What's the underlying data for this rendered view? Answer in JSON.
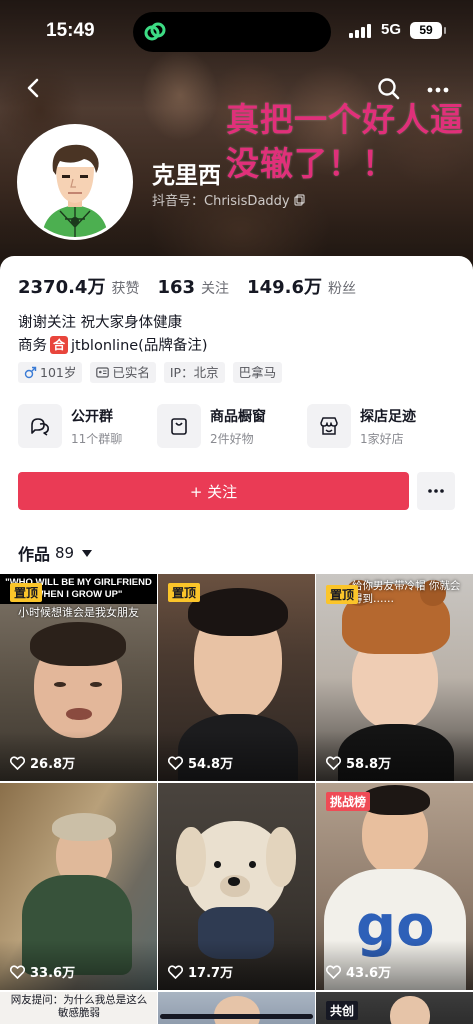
{
  "status_bar": {
    "time": "15:49",
    "network": "5G",
    "battery": "59"
  },
  "header": {
    "overlay_text": "真把一个好人逼没辙了！！",
    "name": "克里西",
    "handle": "抖音号：ChrisisDaddy"
  },
  "stats": [
    {
      "value": "2370.4万",
      "label": "获赞"
    },
    {
      "value": "163",
      "label": "关注"
    },
    {
      "value": "149.6万",
      "label": "粉丝"
    }
  ],
  "bio": {
    "line1": "谢谢关注 祝大家身体健康",
    "business_prefix": "商务",
    "business_badge": "合",
    "business_text": "jtblonline(品牌备注)"
  },
  "tags": [
    {
      "icon": "male-icon",
      "text": "101岁"
    },
    {
      "icon": "id-card-icon",
      "text": "已实名"
    },
    {
      "icon": "",
      "text": "IP：北京"
    },
    {
      "icon": "",
      "text": "巴拿马"
    }
  ],
  "shortcuts": [
    {
      "icon": "group-chat-icon",
      "title": "公开群",
      "sub": "11个群聊"
    },
    {
      "icon": "shop-window-icon",
      "title": "商品橱窗",
      "sub": "2件好物"
    },
    {
      "icon": "store-icon",
      "title": "探店足迹",
      "sub": "1家好店"
    }
  ],
  "actions": {
    "follow": "+ 关注"
  },
  "works": {
    "label": "作品",
    "count": "89"
  },
  "videos": [
    {
      "likes": "26.8万",
      "badge": "置顶",
      "caption_top": "\"WHO WILL BE MY GIRLFRIEND WHEN I GROW UP\"",
      "caption_sub": "小时候想谁会是我女朋友"
    },
    {
      "likes": "54.8万",
      "badge": "置顶"
    },
    {
      "likes": "58.8万",
      "badge": "置顶",
      "caption": "给你男友带冷帽 你就会得到……"
    },
    {
      "likes": "33.6万"
    },
    {
      "likes": "17.7万"
    },
    {
      "likes": "43.6万",
      "badge": "挑战榜"
    },
    {
      "caption": "网友提问：为什么我总是这么敏感脆弱"
    },
    {},
    {
      "caption": "共创"
    }
  ],
  "colors": {
    "accent": "#ea3b55",
    "pin_badge": "#fbc52a",
    "overlay_text": "#e0307a"
  }
}
